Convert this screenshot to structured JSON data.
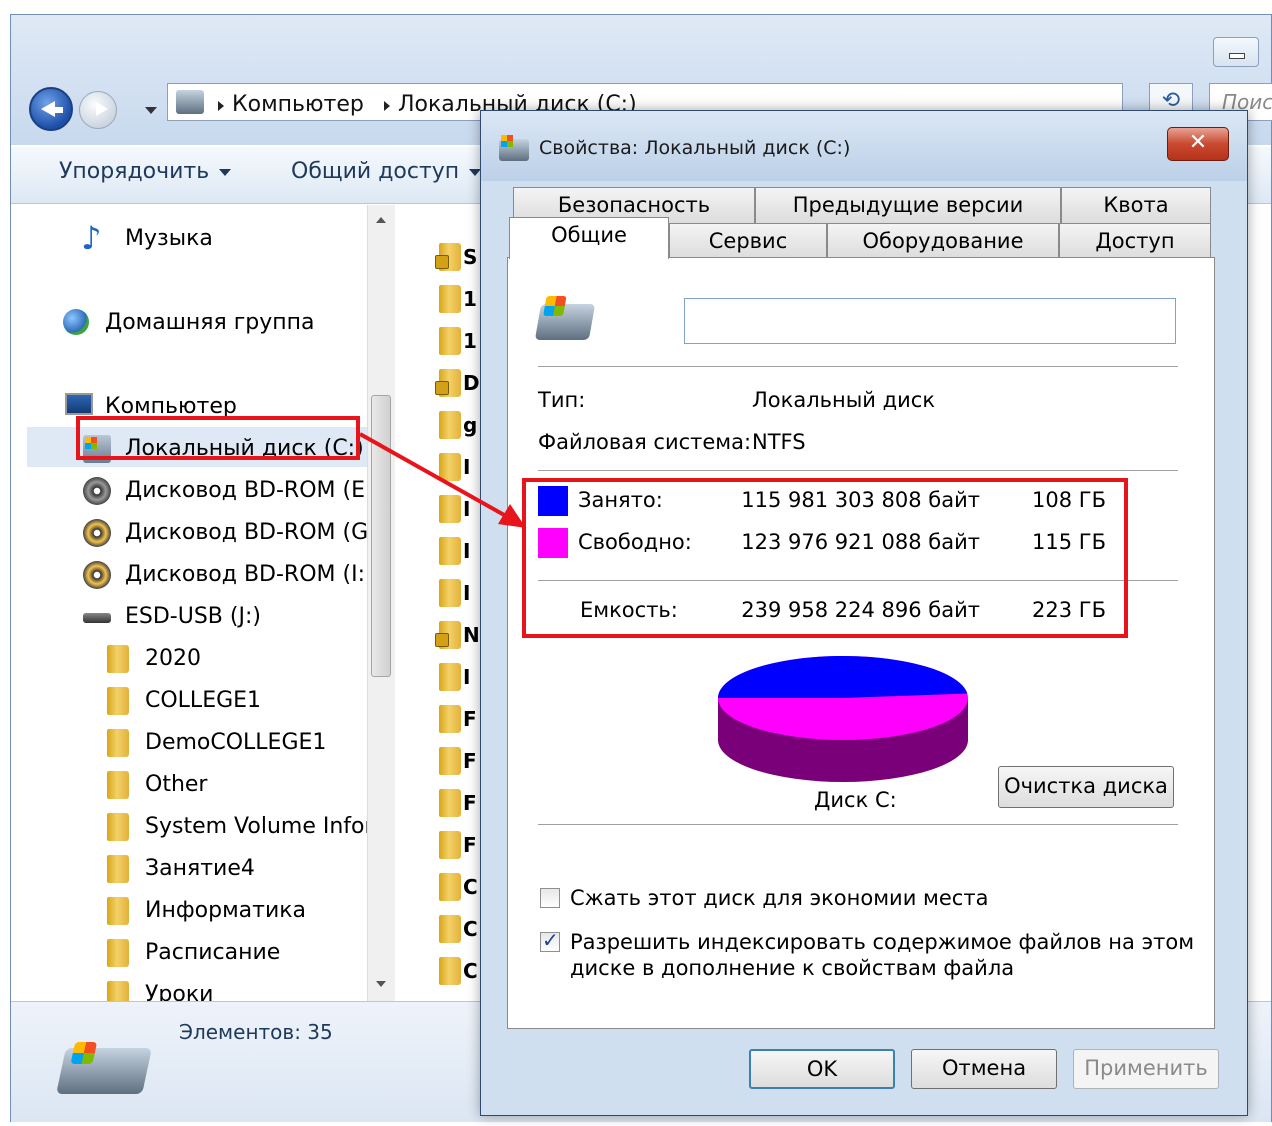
{
  "explorer": {
    "address": {
      "crumbs": [
        "Компьютер",
        "Локальный диск (C:)"
      ]
    },
    "search": {
      "placeholder": "Поис"
    },
    "refresh_glyph": "⟲",
    "toolbar": {
      "organize": "Упорядочить",
      "share": "Общий доступ"
    },
    "nav": {
      "items": [
        {
          "label": "Музыка",
          "icon": "music-icon"
        },
        {
          "label": "Домашняя группа",
          "icon": "homegroup-icon"
        },
        {
          "label": "Компьютер",
          "icon": "computer-icon"
        },
        {
          "label": "Локальный диск (C:)",
          "icon": "local-disk-icon"
        },
        {
          "label": "Дисковод BD-ROM (E:",
          "icon": "bd-rom-icon"
        },
        {
          "label": "Дисковод BD-ROM (G",
          "icon": "bd-rom-icon"
        },
        {
          "label": "Дисковод BD-ROM (I:)",
          "icon": "bd-rom-icon"
        },
        {
          "label": "ESD-USB (J:)",
          "icon": "usb-drive-icon"
        },
        {
          "label": "2020",
          "icon": "folder-icon"
        },
        {
          "label": "COLLEGE1",
          "icon": "folder-icon"
        },
        {
          "label": "DemoCOLLEGE1",
          "icon": "folder-icon"
        },
        {
          "label": "Other",
          "icon": "folder-icon"
        },
        {
          "label": "System Volume Infor",
          "icon": "folder-icon"
        },
        {
          "label": "Занятие4",
          "icon": "folder-icon"
        },
        {
          "label": "Информатика",
          "icon": "folder-icon"
        },
        {
          "label": "Расписание",
          "icon": "folder-icon"
        },
        {
          "label": "Уроки",
          "icon": "folder-icon"
        }
      ]
    },
    "files": [
      {
        "letter": "S",
        "locked": true
      },
      {
        "letter": "1",
        "locked": false
      },
      {
        "letter": "1",
        "locked": false
      },
      {
        "letter": "D",
        "locked": true
      },
      {
        "letter": "g",
        "locked": false
      },
      {
        "letter": "I",
        "locked": false
      },
      {
        "letter": "I",
        "locked": false
      },
      {
        "letter": "I",
        "locked": false
      },
      {
        "letter": "I",
        "locked": false
      },
      {
        "letter": "N",
        "locked": true
      },
      {
        "letter": "I",
        "locked": false
      },
      {
        "letter": "F",
        "locked": false
      },
      {
        "letter": "F",
        "locked": false
      },
      {
        "letter": "F",
        "locked": false
      },
      {
        "letter": "F",
        "locked": false
      },
      {
        "letter": "C",
        "locked": false
      },
      {
        "letter": "C",
        "locked": false
      },
      {
        "letter": "C",
        "locked": false
      }
    ],
    "status": {
      "items_count": "Элементов: 35"
    }
  },
  "dialog": {
    "title": "Свойства: Локальный диск (C:)",
    "close_glyph": "✕",
    "tabs_back": [
      "Безопасность",
      "Предыдущие версии",
      "Квота"
    ],
    "tabs_front": [
      "Общие",
      "Сервис",
      "Оборудование",
      "Доступ"
    ],
    "active_tab": "Общие",
    "drive_label_value": "",
    "type_label": "Тип:",
    "type_value": "Локальный диск",
    "fs_label": "Файловая система:",
    "fs_value": "NTFS",
    "used": {
      "label": "Занято:",
      "bytes": "115 981 303 808 байт",
      "size": "108 ГБ",
      "color": "#0000ff"
    },
    "free": {
      "label": "Свободно:",
      "bytes": "123 976 921 088 байт",
      "size": "115 ГБ",
      "color": "#ff00ff"
    },
    "capacity": {
      "label": "Емкость:",
      "bytes": "239 958 224 896 байт",
      "size": "223 ГБ"
    },
    "pie": {
      "used_fraction": 0.483,
      "free_fraction": 0.517
    },
    "disk_label": "Диск C:",
    "cleanup_button": "Очистка диска",
    "compress": {
      "label": "Сжать этот диск для экономии места",
      "checked": false
    },
    "index": {
      "label_line1": "Разрешить индексировать содержимое файлов на этом",
      "label_line2": "диске в дополнение к свойствам файла",
      "checked": true
    },
    "buttons": {
      "ok": "OK",
      "cancel": "Отмена",
      "apply": "Применить"
    }
  },
  "annotation": {
    "highlight_color": "#e8141b"
  }
}
